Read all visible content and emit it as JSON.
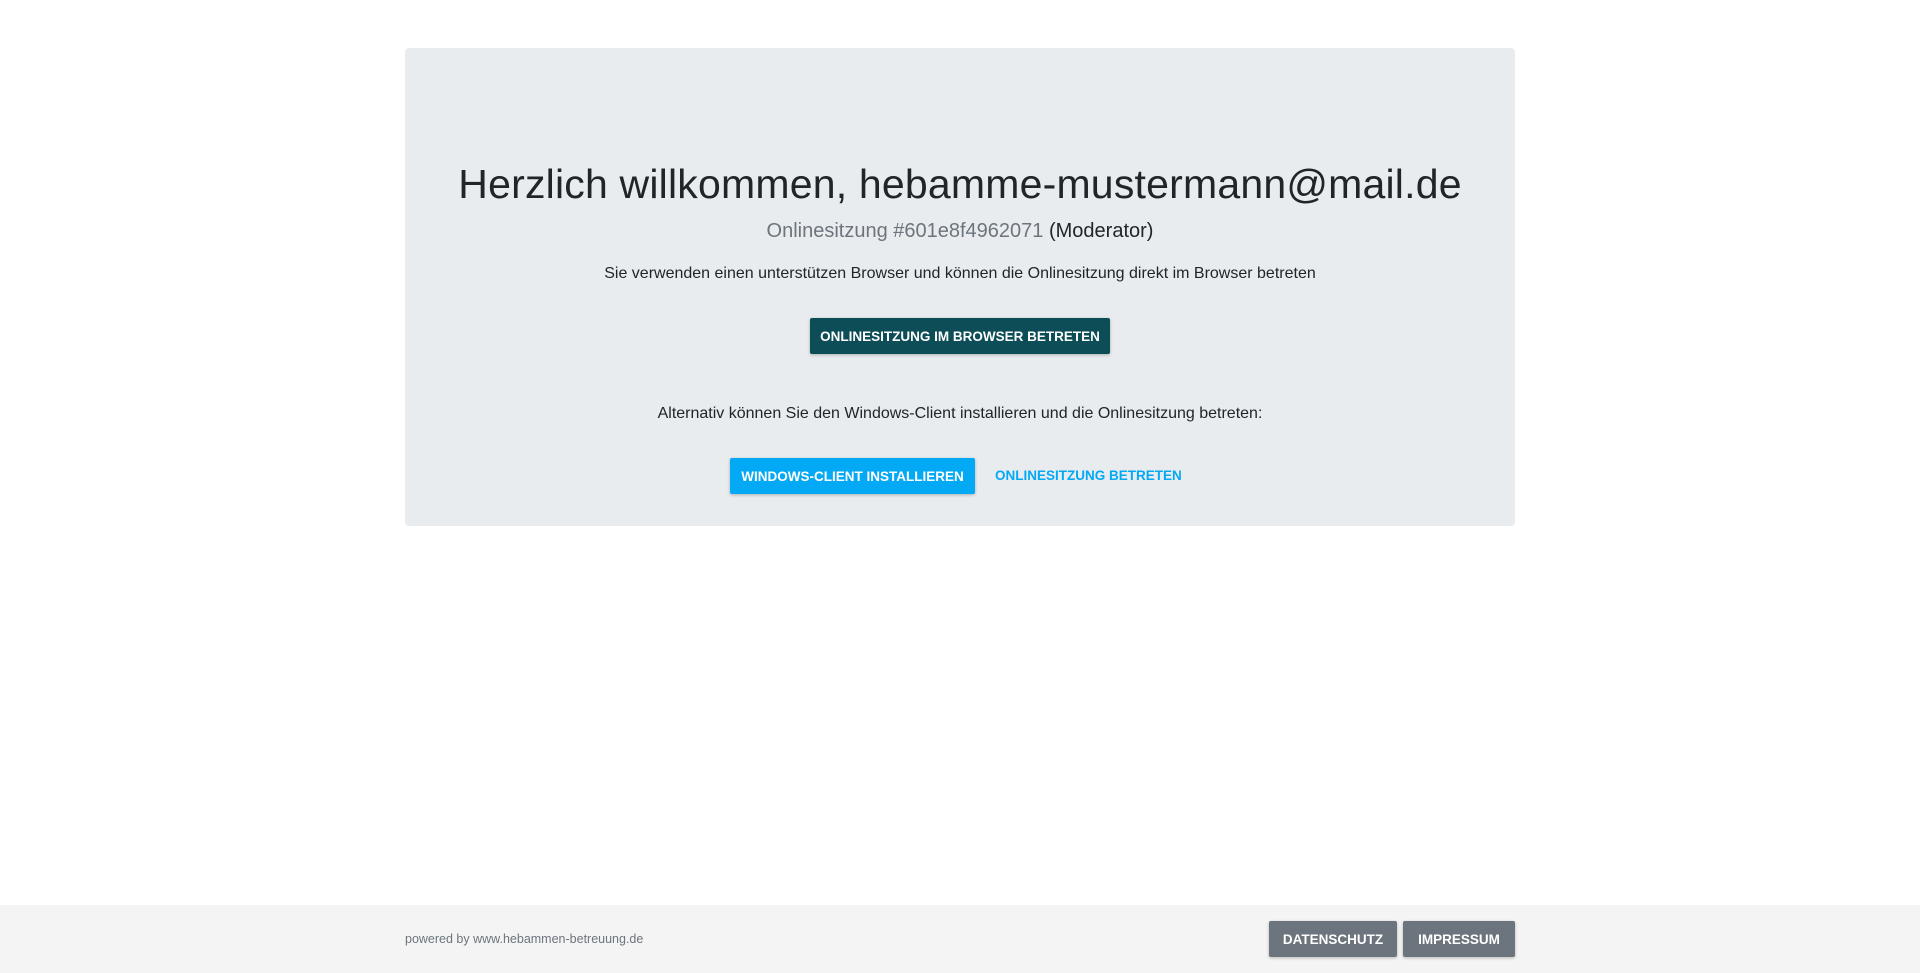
{
  "welcome": {
    "title": "Herzlich willkommen, hebamme-mustermann@mail.de",
    "session_prefix": "Onlinesitzung #601e8f4962071",
    "session_role": "(Moderator)",
    "browser_info": "Sie verwenden einen unterstützen Browser und können die Onlinesitzung direkt im Browser betreten",
    "browser_button": "Onlinesitzung im Browser betreten",
    "alternative_info": "Alternativ können Sie den Windows-Client installieren und die Onlinesitzung betreten:",
    "install_button": "Windows-Client installieren",
    "join_link": "Onlinesitzung betreten"
  },
  "footer": {
    "powered_by": "powered by www.hebammen-betreuung.de",
    "datenschutz_label": "Datenschutz",
    "impressum_label": "Impressum"
  },
  "colors": {
    "card_background": "#e9ecef",
    "primary_dark": "#0d4d57",
    "accent_blue": "#03a9f4",
    "footer_button": "#6c757d",
    "footer_background": "#f4f4f4"
  }
}
